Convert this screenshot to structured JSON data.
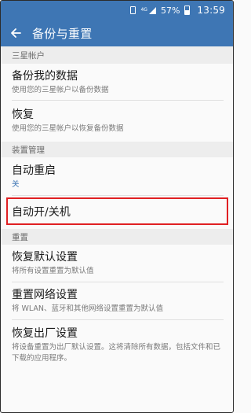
{
  "status_bar": {
    "battery": "57%",
    "time": "13:59",
    "network": "4G",
    "icons": [
      "sim-icon",
      "signal-icon",
      "battery-icon"
    ]
  },
  "app_bar": {
    "title": "备份与重置",
    "back_icon": "back-arrow-icon"
  },
  "sections": [
    {
      "header": "三星帐户",
      "items": [
        {
          "label": "备份我的数据",
          "sub": "使用您的三星帐户以备份数据"
        },
        {
          "label": "恢复",
          "sub": "使用您的三星帐户以恢复备份数据"
        }
      ]
    },
    {
      "header": "装置管理",
      "items": [
        {
          "label": "自动重启",
          "sub": "关"
        },
        {
          "label": "自动开/关机",
          "sub": ""
        }
      ]
    },
    {
      "header": "重置",
      "items": [
        {
          "label": "恢复默认设置",
          "sub": "将所有设置重置为默认值"
        },
        {
          "label": "重置网络设置",
          "sub": "将 WLAN、蓝牙和其他网络设置重置为默认值"
        },
        {
          "label": "恢复出厂设置",
          "sub": "将设备重置为出厂默认设置。这将清除所有数据，包括文件和已下载的应用程序。"
        }
      ]
    }
  ],
  "colors": {
    "accent": "#3e76b4",
    "highlight_border": "#e01f22",
    "section_bg": "#ededed"
  }
}
